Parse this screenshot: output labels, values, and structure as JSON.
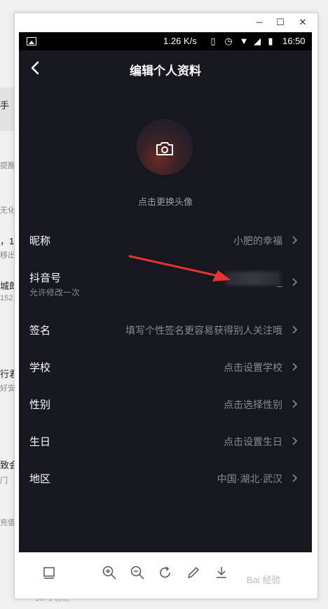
{
  "background": {
    "snippets": [
      "手",
      "提醒",
      "无化",
      "，1",
      "移出",
      "城郎",
      "152",
      "行君",
      "好安",
      "致会",
      "门",
      "充值"
    ],
    "bottom_snippet": "1071 粉丝"
  },
  "window": {
    "minimize": "─",
    "maximize": "☐",
    "close": "✕"
  },
  "statusbar": {
    "speed": "1.26 K/s",
    "time": "16:50"
  },
  "header": {
    "title": "编辑个人资料"
  },
  "avatar": {
    "hint": "点击更换头像"
  },
  "fields": [
    {
      "label": "昵称",
      "value": "小肥的幸福"
    },
    {
      "label": "抖音号",
      "sub": "允许修改一次",
      "value": "_"
    },
    {
      "label": "签名",
      "value": "填写个性签名更容易获得别人关注哦"
    },
    {
      "label": "学校",
      "value": "点击设置学校"
    },
    {
      "label": "性别",
      "value": "点击选择性别"
    },
    {
      "label": "生日",
      "value": "点击设置生日"
    },
    {
      "label": "地区",
      "value": "中国·湖北·武汉"
    }
  ],
  "toolbar": {
    "icons": [
      "screen-icon",
      "zoom-in-icon",
      "zoom-out-icon",
      "rotate-icon",
      "edit-icon",
      "download-icon"
    ]
  },
  "watermark": "Bai 经验",
  "colors": {
    "phone_bg": "#17171f",
    "arrow": "#e8342f"
  }
}
